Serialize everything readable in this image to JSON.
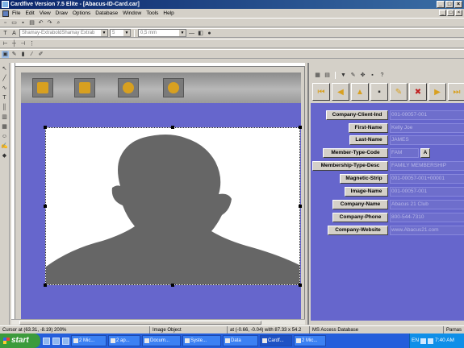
{
  "window": {
    "title": "Cardfive Version 7.5 Elite - [Abacus-ID-Card.car]",
    "controls": [
      "_",
      "□",
      "×"
    ]
  },
  "menu": {
    "items": [
      "File",
      "Edit",
      "View",
      "Draw",
      "Options",
      "Database",
      "Window",
      "Tools",
      "Help"
    ],
    "mdi_controls": [
      "_",
      "□",
      "×"
    ]
  },
  "toolbar": {
    "font_name": "Shamay-ExtraboldShamay Extrab",
    "font_size": "5",
    "line_width": "0,5 mm"
  },
  "record": {
    "fields": [
      {
        "label": "Company-Client-Ind",
        "value": "001-00057-001"
      },
      {
        "label": "First-Name",
        "value": "Kelly Joe"
      },
      {
        "label": "Last-Name",
        "value": "JAMES"
      },
      {
        "label": "Member-Type-Code",
        "value": "FAM",
        "has_lookup": true,
        "lookup_label": "A"
      },
      {
        "label": "Membership-Type-Desc",
        "value": "FAMILY MEMBERSHIP"
      },
      {
        "label": "Magnetic-Strip",
        "value": "001-00057-001+00001"
      },
      {
        "label": "Image-Name",
        "value": "001-00057-001"
      },
      {
        "label": "Company-Name",
        "value": "Abacus 21 Club"
      },
      {
        "label": "Company-Phone",
        "value": "800-544-7310"
      },
      {
        "label": "Company-Website",
        "value": "www.Abacus21.com"
      }
    ]
  },
  "statusbar": {
    "cursor": "Cursor at (63.31, -8.19) 200%",
    "object": "Image Object",
    "position": "at (-0.66, -0.04) with 87.33 x 54.2",
    "database": "MS Access Database",
    "extra": "Parnas"
  },
  "taskbar": {
    "start_label": "start",
    "tasks": [
      "2 Mic...",
      "2 ap...",
      "Docum...",
      "Syste...",
      "Data",
      "Cardf...",
      "2 Mic..."
    ],
    "active_task": "Cardf...",
    "tray_lang": "EN",
    "clock": "7:40 AM"
  }
}
